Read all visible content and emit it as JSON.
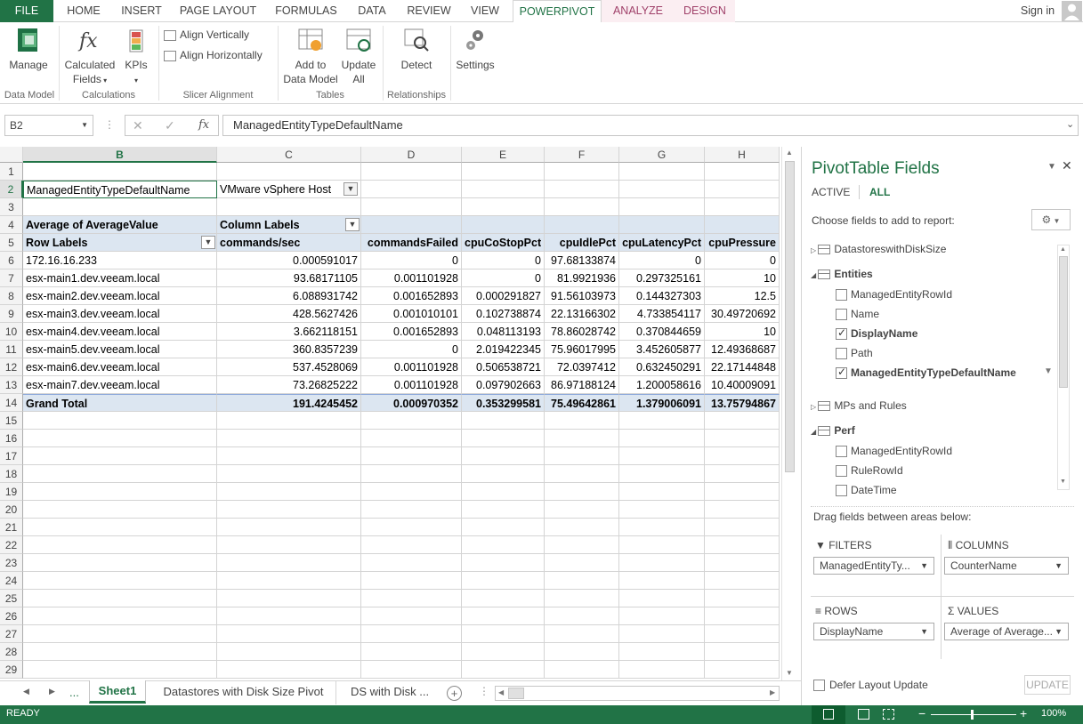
{
  "ribbon_tabs": [
    "FILE",
    "HOME",
    "INSERT",
    "PAGE LAYOUT",
    "FORMULAS",
    "DATA",
    "REVIEW",
    "VIEW",
    "POWERPIVOT",
    "ANALYZE",
    "DESIGN"
  ],
  "sign_in": "Sign in",
  "ribbon": {
    "manage": "Manage",
    "calculated_fields": "Calculated",
    "calculated_fields_2": "Fields",
    "kpis": "KPIs",
    "align_vertically": "Align Vertically",
    "align_horizontally": "Align Horizontally",
    "add_to_model": "Add to",
    "add_to_model_2": "Data Model",
    "update_all": "Update",
    "update_all_2": "All",
    "detect": "Detect",
    "settings": "Settings",
    "groups": [
      "Data Model",
      "Calculations",
      "Slicer Alignment",
      "Tables",
      "Relationships"
    ]
  },
  "formula_bar": {
    "name_box": "B2",
    "fx": "fx",
    "formula": "ManagedEntityTypeDefaultName"
  },
  "columns": [
    "B",
    "C",
    "D",
    "E",
    "F",
    "G",
    "H"
  ],
  "rows": [
    "1",
    "2",
    "3",
    "4",
    "5",
    "6",
    "7",
    "8",
    "9",
    "10",
    "11",
    "12",
    "13",
    "14",
    "15",
    "16",
    "17",
    "18",
    "19",
    "20",
    "21",
    "22",
    "23",
    "24",
    "25",
    "26",
    "27",
    "28",
    "29"
  ],
  "pivot": {
    "filter_field": "ManagedEntityTypeDefaultName",
    "filter_value": "VMware vSphere Host",
    "values_label": "Average of AverageValue",
    "column_labels": "Column Labels",
    "row_labels": "Row Labels",
    "headers": [
      "commands/sec",
      "commandsFailed",
      "cpuCoStopPct",
      "cpuIdlePct",
      "cpuLatencyPct",
      "cpuPressure"
    ],
    "data": [
      [
        "172.16.16.233",
        "0.000591017",
        "0",
        "0",
        "97.68133874",
        "0",
        "0"
      ],
      [
        "esx-main1.dev.veeam.local",
        "93.68171105",
        "0.001101928",
        "0",
        "81.9921936",
        "0.297325161",
        "10"
      ],
      [
        "esx-main2.dev.veeam.local",
        "6.088931742",
        "0.001652893",
        "0.000291827",
        "91.56103973",
        "0.144327303",
        "12.5"
      ],
      [
        "esx-main3.dev.veeam.local",
        "428.5627426",
        "0.001010101",
        "0.102738874",
        "22.13166302",
        "4.733854117",
        "30.49720692"
      ],
      [
        "esx-main4.dev.veeam.local",
        "3.662118151",
        "0.001652893",
        "0.048113193",
        "78.86028742",
        "0.370844659",
        "10"
      ],
      [
        "esx-main5.dev.veeam.local",
        "360.8357239",
        "0",
        "2.019422345",
        "75.96017995",
        "3.452605877",
        "12.49368687"
      ],
      [
        "esx-main6.dev.veeam.local",
        "537.4528069",
        "0.001101928",
        "0.506538721",
        "72.0397412",
        "0.632450291",
        "22.17144848"
      ],
      [
        "esx-main7.dev.veeam.local",
        "73.26825222",
        "0.001101928",
        "0.097902663",
        "86.97188124",
        "1.200058616",
        "10.40009091"
      ]
    ],
    "grand_total": [
      "Grand Total",
      "191.4245452",
      "0.000970352",
      "0.353299581",
      "75.49642861",
      "1.379006091",
      "13.75794867"
    ]
  },
  "sheets": {
    "ellipsis": "...",
    "active": "Sheet1",
    "tab2": "Datastores with Disk Size Pivot",
    "tab3": "DS with Disk ..."
  },
  "status": {
    "ready": "READY",
    "zoom": "100%"
  },
  "pane": {
    "title": "PivotTable Fields",
    "tab_active": "ACTIVE",
    "tab_all": "ALL",
    "choose": "Choose fields to add to report:",
    "tables": [
      {
        "name": "DatastoreswithDiskSize"
      },
      {
        "name": "Entities",
        "fields": [
          {
            "name": "ManagedEntityRowId",
            "checked": false
          },
          {
            "name": "Name",
            "checked": false
          },
          {
            "name": "DisplayName",
            "checked": true
          },
          {
            "name": "Path",
            "checked": false
          },
          {
            "name": "ManagedEntityTypeDefaultName",
            "checked": true
          }
        ]
      },
      {
        "name": "MPs and Rules"
      },
      {
        "name": "Perf",
        "fields": [
          {
            "name": "ManagedEntityRowId",
            "checked": false
          },
          {
            "name": "RuleRowId",
            "checked": false
          },
          {
            "name": "DateTime",
            "checked": false
          }
        ]
      }
    ],
    "drag": "Drag fields between areas below:",
    "filters": "FILTERS",
    "columns": "COLUMNS",
    "rows": "ROWS",
    "values": "VALUES",
    "filters_value": "ManagedEntityTy...",
    "columns_value": "CounterName",
    "rows_value": "DisplayName",
    "values_value": "Average of Average...",
    "defer": "Defer Layout Update",
    "update": "UPDATE"
  },
  "colors": {
    "excel_green": "#217346",
    "pivot_blue": "#dce6f1",
    "context_tab": "#a0416a"
  }
}
